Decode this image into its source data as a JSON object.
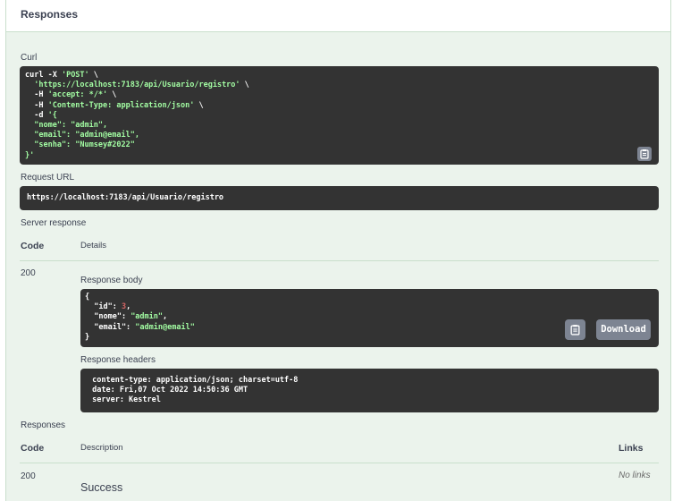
{
  "section_title": "Responses",
  "curl": {
    "label": "Curl",
    "lines": [
      [
        {
          "t": "curl -X ",
          "c": "w"
        },
        {
          "t": "'POST'",
          "c": "s"
        },
        {
          "t": " \\",
          "c": "w"
        }
      ],
      [
        {
          "t": "  ",
          "c": "w"
        },
        {
          "t": "'https://localhost:7183/api/Usuario/registro'",
          "c": "s"
        },
        {
          "t": " \\",
          "c": "w"
        }
      ],
      [
        {
          "t": "  -H ",
          "c": "w"
        },
        {
          "t": "'accept: */*'",
          "c": "s"
        },
        {
          "t": " \\",
          "c": "w"
        }
      ],
      [
        {
          "t": "  -H ",
          "c": "w"
        },
        {
          "t": "'Content-Type: application/json'",
          "c": "s"
        },
        {
          "t": " \\",
          "c": "w"
        }
      ],
      [
        {
          "t": "  -d ",
          "c": "w"
        },
        {
          "t": "'{",
          "c": "s"
        }
      ],
      [
        {
          "t": "  \"nome\": \"admin\",",
          "c": "s"
        }
      ],
      [
        {
          "t": "  \"email\": \"admin@email\",",
          "c": "s"
        }
      ],
      [
        {
          "t": "  \"senha\": \"Numsey#2022\"",
          "c": "s"
        }
      ],
      [
        {
          "t": "}'",
          "c": "s"
        }
      ]
    ]
  },
  "request_url": {
    "label": "Request URL",
    "value": "https://localhost:7183/api/Usuario/registro"
  },
  "server_response": {
    "label": "Server response",
    "col_code": "Code",
    "col_details": "Details",
    "code": "200",
    "body_label": "Response body",
    "body_lines": [
      [
        {
          "t": "{",
          "c": "w"
        }
      ],
      [
        {
          "t": "  \"id\": ",
          "c": "w"
        },
        {
          "t": "3",
          "c": "n"
        },
        {
          "t": ",",
          "c": "w"
        }
      ],
      [
        {
          "t": "  \"nome\": ",
          "c": "w"
        },
        {
          "t": "\"admin\"",
          "c": "s"
        },
        {
          "t": ",",
          "c": "w"
        }
      ],
      [
        {
          "t": "  \"email\": ",
          "c": "w"
        },
        {
          "t": "\"admin@email\"",
          "c": "s"
        }
      ],
      [
        {
          "t": "}",
          "c": "w"
        }
      ]
    ],
    "download_label": "Download",
    "headers_label": "Response headers",
    "headers_lines": [
      " content-type: application/json; charset=utf-8 ",
      " date: Fri,07 Oct 2022 14:50:36 GMT ",
      " server: Kestrel "
    ]
  },
  "responses": {
    "label": "Responses",
    "col_code": "Code",
    "col_description": "Description",
    "col_links": "Links",
    "code": "200",
    "description": "Success",
    "links": "No links"
  },
  "icons": {
    "copy": "clipboard-icon"
  }
}
